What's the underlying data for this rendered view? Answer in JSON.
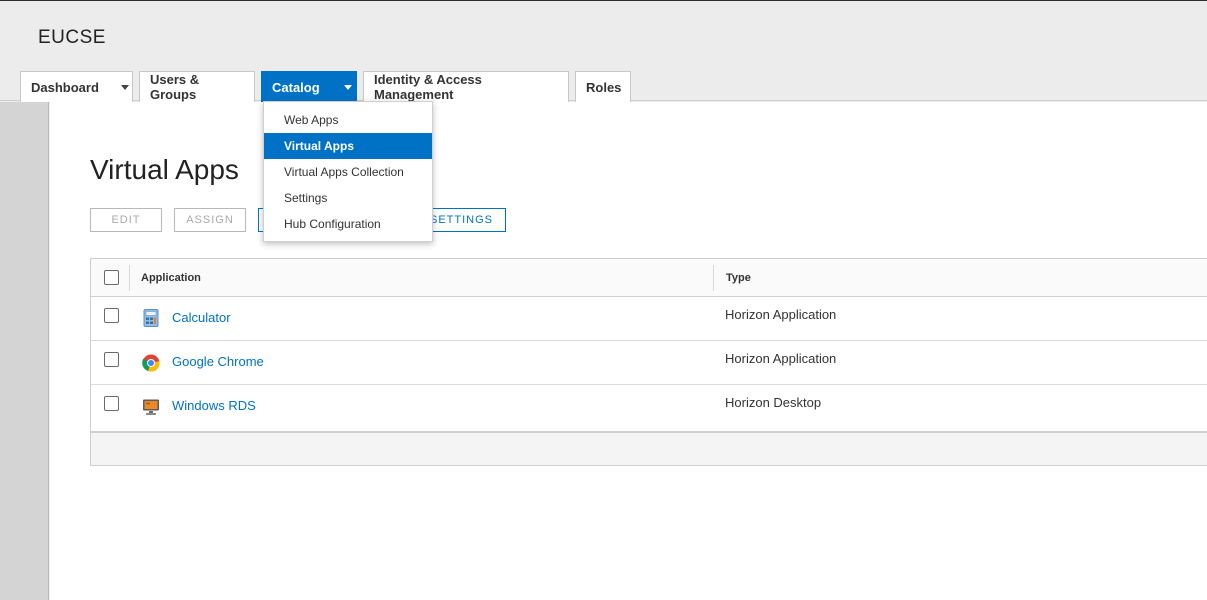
{
  "org": {
    "name": "EUCSE"
  },
  "nav": {
    "tabs": [
      {
        "label": "Dashboard",
        "has_dropdown": true,
        "active": false
      },
      {
        "label": "Users & Groups",
        "has_dropdown": false,
        "active": false
      },
      {
        "label": "Catalog",
        "has_dropdown": true,
        "active": true
      },
      {
        "label": "Identity & Access Management",
        "has_dropdown": false,
        "active": false
      },
      {
        "label": "Roles",
        "has_dropdown": false,
        "active": false
      }
    ]
  },
  "catalog_menu": {
    "items": [
      {
        "label": "Web Apps",
        "selected": false
      },
      {
        "label": "Virtual Apps",
        "selected": true
      },
      {
        "label": "Virtual Apps Collection",
        "selected": false
      },
      {
        "label": "Settings",
        "selected": false
      },
      {
        "label": "Hub Configuration",
        "selected": false
      }
    ]
  },
  "page": {
    "title": "Virtual Apps",
    "actions": {
      "edit_label": "EDIT",
      "assign_label": "ASSIGN",
      "settings_label": "SETTINGS"
    }
  },
  "grid": {
    "columns": {
      "application": "Application",
      "type": "Type"
    },
    "rows": [
      {
        "name": "Calculator",
        "type": "Horizon Application",
        "icon": "calculator-icon"
      },
      {
        "name": "Google Chrome",
        "type": "Horizon Application",
        "icon": "chrome-icon"
      },
      {
        "name": "Windows RDS",
        "type": "Horizon Desktop",
        "icon": "rds-desktop-icon"
      }
    ]
  },
  "colors": {
    "accent": "#0072c6",
    "header_bg": "#ececec",
    "rail_bg": "#d4d4d4"
  }
}
